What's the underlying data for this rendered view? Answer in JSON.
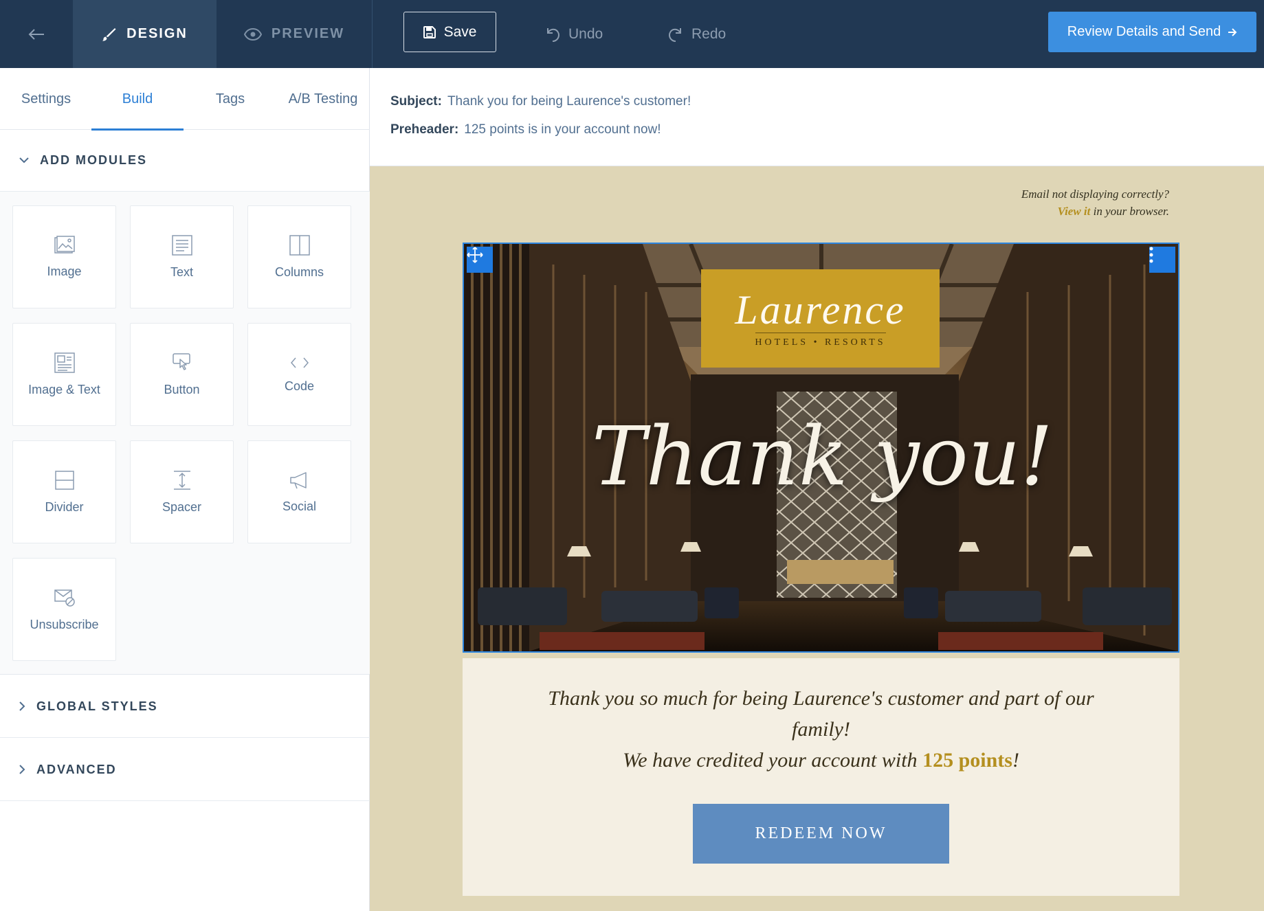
{
  "topbar": {
    "design_label": "DESIGN",
    "preview_label": "PREVIEW",
    "save_label": "Save",
    "undo_label": "Undo",
    "redo_label": "Redo",
    "review_label": "Review Details and Send",
    "active_tab": "DESIGN",
    "colors": {
      "background": "#213853",
      "active_tab": "#2f4965",
      "review_button": "#3c8fe0"
    }
  },
  "sidebar": {
    "tabs": [
      {
        "label": "Settings",
        "active": false
      },
      {
        "label": "Build",
        "active": true
      },
      {
        "label": "Tags",
        "active": false
      },
      {
        "label": "A/B Testing",
        "active": false
      }
    ],
    "add_modules": {
      "title": "ADD MODULES",
      "expanded": true,
      "modules": [
        {
          "label": "Image",
          "icon": "image-icon"
        },
        {
          "label": "Text",
          "icon": "text-icon"
        },
        {
          "label": "Columns",
          "icon": "columns-icon"
        },
        {
          "label": "Image & Text",
          "icon": "image-text-icon"
        },
        {
          "label": "Button",
          "icon": "button-icon"
        },
        {
          "label": "Code",
          "icon": "code-icon"
        },
        {
          "label": "Divider",
          "icon": "divider-icon"
        },
        {
          "label": "Spacer",
          "icon": "spacer-icon"
        },
        {
          "label": "Social",
          "icon": "social-icon"
        },
        {
          "label": "Unsubscribe",
          "icon": "unsubscribe-icon"
        }
      ]
    },
    "global_styles": {
      "title": "GLOBAL STYLES",
      "expanded": false
    },
    "advanced": {
      "title": "ADVANCED",
      "expanded": false
    }
  },
  "email": {
    "subject_label": "Subject:",
    "subject": "Thank you for being Laurence's customer!",
    "preheader_label": "Preheader:",
    "preheader": "125 points is in your account now!",
    "browser_note_line1": "Email not displaying correctly?",
    "browser_note_link": "View it",
    "browser_note_rest": " in your browser.",
    "hero": {
      "brand_name": "Laurence",
      "brand_tagline": "HOTELS • RESORTS",
      "headline": "Thank you!"
    },
    "body_line1": "Thank you so much for being Laurence's customer and part of our family!",
    "body_line2_prefix": "We have credited your account with ",
    "body_points": "125 points",
    "body_line2_suffix": "!",
    "cta_label": "REDEEM NOW",
    "colors": {
      "canvas": "#dfd6b6",
      "content": "#f4efe3",
      "accent_gold": "#b48f1f",
      "logo_box": "#c99e26",
      "cta": "#5e8cc0",
      "selection": "#2d86e0"
    }
  }
}
